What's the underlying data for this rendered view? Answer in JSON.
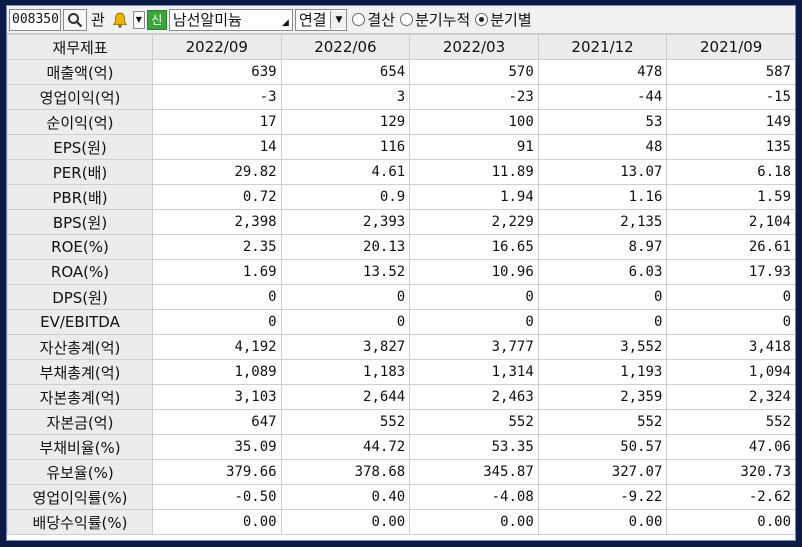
{
  "toolbar": {
    "stock_code": "008350",
    "label_gwan": "관",
    "new_badge": "신",
    "company_name": "남선알미늄",
    "consolidation": "연결",
    "radio_options": [
      {
        "label": "결산",
        "selected": false
      },
      {
        "label": "분기누적",
        "selected": false
      },
      {
        "label": "분기별",
        "selected": true
      }
    ]
  },
  "table": {
    "header": [
      "재무제표",
      "2022/09",
      "2022/06",
      "2022/03",
      "2021/12",
      "2021/09"
    ],
    "rows": [
      {
        "label": "매출액(억)",
        "values": [
          "639",
          "654",
          "570",
          "478",
          "587"
        ]
      },
      {
        "label": "영업이익(억)",
        "values": [
          "-3",
          "3",
          "-23",
          "-44",
          "-15"
        ]
      },
      {
        "label": "순이익(억)",
        "values": [
          "17",
          "129",
          "100",
          "53",
          "149"
        ]
      },
      {
        "label": "EPS(원)",
        "values": [
          "14",
          "116",
          "91",
          "48",
          "135"
        ]
      },
      {
        "label": "PER(배)",
        "values": [
          "29.82",
          "4.61",
          "11.89",
          "13.07",
          "6.18"
        ]
      },
      {
        "label": "PBR(배)",
        "values": [
          "0.72",
          "0.9",
          "1.94",
          "1.16",
          "1.59"
        ]
      },
      {
        "label": "BPS(원)",
        "values": [
          "2,398",
          "2,393",
          "2,229",
          "2,135",
          "2,104"
        ]
      },
      {
        "label": "ROE(%)",
        "values": [
          "2.35",
          "20.13",
          "16.65",
          "8.97",
          "26.61"
        ]
      },
      {
        "label": "ROA(%)",
        "values": [
          "1.69",
          "13.52",
          "10.96",
          "6.03",
          "17.93"
        ]
      },
      {
        "label": "DPS(원)",
        "values": [
          "0",
          "0",
          "0",
          "0",
          "0"
        ]
      },
      {
        "label": "EV/EBITDA",
        "values": [
          "0",
          "0",
          "0",
          "0",
          "0"
        ]
      },
      {
        "label": "자산총계(억)",
        "values": [
          "4,192",
          "3,827",
          "3,777",
          "3,552",
          "3,418"
        ]
      },
      {
        "label": "부채총계(억)",
        "values": [
          "1,089",
          "1,183",
          "1,314",
          "1,193",
          "1,094"
        ]
      },
      {
        "label": "자본총계(억)",
        "values": [
          "3,103",
          "2,644",
          "2,463",
          "2,359",
          "2,324"
        ]
      },
      {
        "label": "자본금(억)",
        "values": [
          "647",
          "552",
          "552",
          "552",
          "552"
        ]
      },
      {
        "label": "부채비율(%)",
        "values": [
          "35.09",
          "44.72",
          "53.35",
          "50.57",
          "47.06"
        ]
      },
      {
        "label": "유보율(%)",
        "values": [
          "379.66",
          "378.68",
          "345.87",
          "327.07",
          "320.73"
        ]
      },
      {
        "label": "영업이익률(%)",
        "values": [
          "-0.50",
          "0.40",
          "-4.08",
          "-9.22",
          "-2.62"
        ]
      },
      {
        "label": "배당수익률(%)",
        "values": [
          "0.00",
          "0.00",
          "0.00",
          "0.00",
          "0.00"
        ]
      }
    ]
  },
  "colors": {
    "background": "#0b1a47",
    "header_bg": "#ececec",
    "new_badge": "#3aa53a"
  },
  "icons": [
    "search-icon",
    "bell-icon",
    "chevron-down-icon"
  ]
}
